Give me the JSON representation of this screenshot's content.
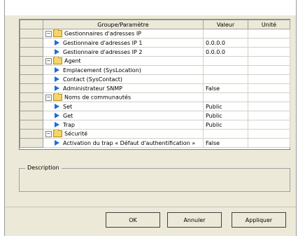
{
  "table": {
    "headers": [
      "Groupe/Paramètre",
      "Valeur",
      "Unité"
    ],
    "rows": [
      {
        "type": "folder",
        "label": "Gestionnaires d'adresses IP",
        "value": ""
      },
      {
        "type": "leaf",
        "label": "Gestionnaire d'adresses IP 1",
        "value": "0.0.0.0"
      },
      {
        "type": "leaf",
        "label": "Gestionnaire d'adresses IP 2",
        "value": "0.0.0.0"
      },
      {
        "type": "folder",
        "label": "Agent",
        "value": ""
      },
      {
        "type": "leaf",
        "label": "Emplacement (SysLocation)",
        "value": ""
      },
      {
        "type": "leaf",
        "label": "Contact (SysContact)",
        "value": ""
      },
      {
        "type": "leaf",
        "label": "Administrateur SNMP",
        "value": "False"
      },
      {
        "type": "folder",
        "label": "Noms de communautés",
        "value": ""
      },
      {
        "type": "leaf",
        "label": "Set",
        "value": "Public"
      },
      {
        "type": "leaf",
        "label": "Get",
        "value": "Public"
      },
      {
        "type": "leaf",
        "label": "Trap",
        "value": "Public"
      },
      {
        "type": "folder",
        "label": "Sécurité",
        "value": ""
      },
      {
        "type": "leaf",
        "label": "Activation du trap « Défaut d'authentification »",
        "value": "False"
      }
    ]
  },
  "description": {
    "label": "Description"
  },
  "buttons": {
    "ok": "OK",
    "cancel": "Annuler",
    "apply": "Appliquer"
  }
}
